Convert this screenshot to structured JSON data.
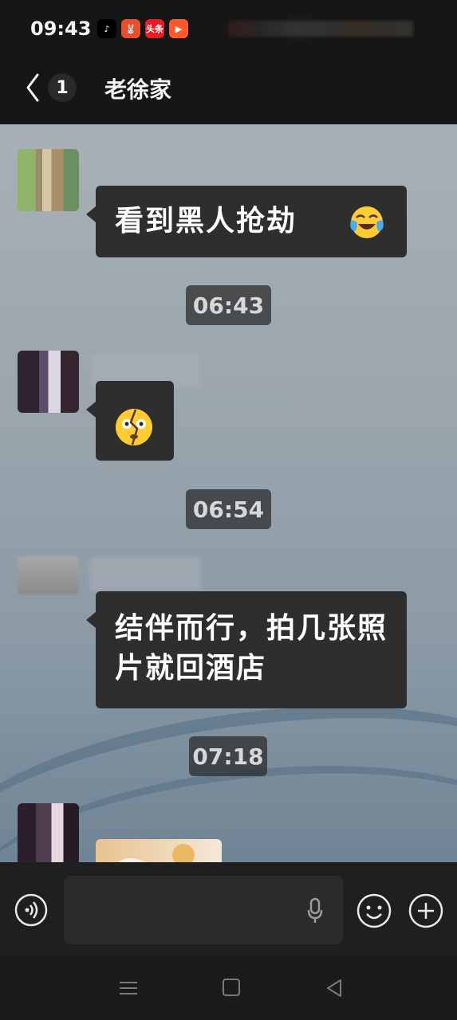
{
  "status_bar": {
    "time": "09:43",
    "apps": [
      {
        "name": "tiktok-icon",
        "label": "♪",
        "color": "#000000"
      },
      {
        "name": "toutiao-game-icon",
        "label": "🐰",
        "color": "#e94e2c"
      },
      {
        "name": "toutiao-icon",
        "label": "头条",
        "color": "#e61e22"
      },
      {
        "name": "video-app-icon",
        "label": "▶",
        "color": "#ff5b2a"
      }
    ]
  },
  "header": {
    "back_icon": "chevron-left",
    "unread_count": "1",
    "title": "老徐家"
  },
  "messages": [
    {
      "type": "text",
      "text": "看到黑人抢劫",
      "emoji": "crying-laughing-face"
    },
    {
      "type": "timestamp",
      "text": "06:43"
    },
    {
      "type": "emoji",
      "emoji": "broken-heart-shocked-face"
    },
    {
      "type": "timestamp",
      "text": "06:54"
    },
    {
      "type": "text",
      "text": "结伴而行，拍几张照片就回酒店"
    },
    {
      "type": "timestamp",
      "text": "07:18"
    },
    {
      "type": "image",
      "emoji": "sun-pattern-plate"
    }
  ],
  "composer": {
    "voice_icon": "voice-wave",
    "mic_icon": "microphone",
    "emoji_icon": "smiley",
    "plus_icon": "plus"
  },
  "colors": {
    "bubble": "#2e2e2e",
    "chat_bg": "#9aa5ad",
    "header": "#161616"
  }
}
